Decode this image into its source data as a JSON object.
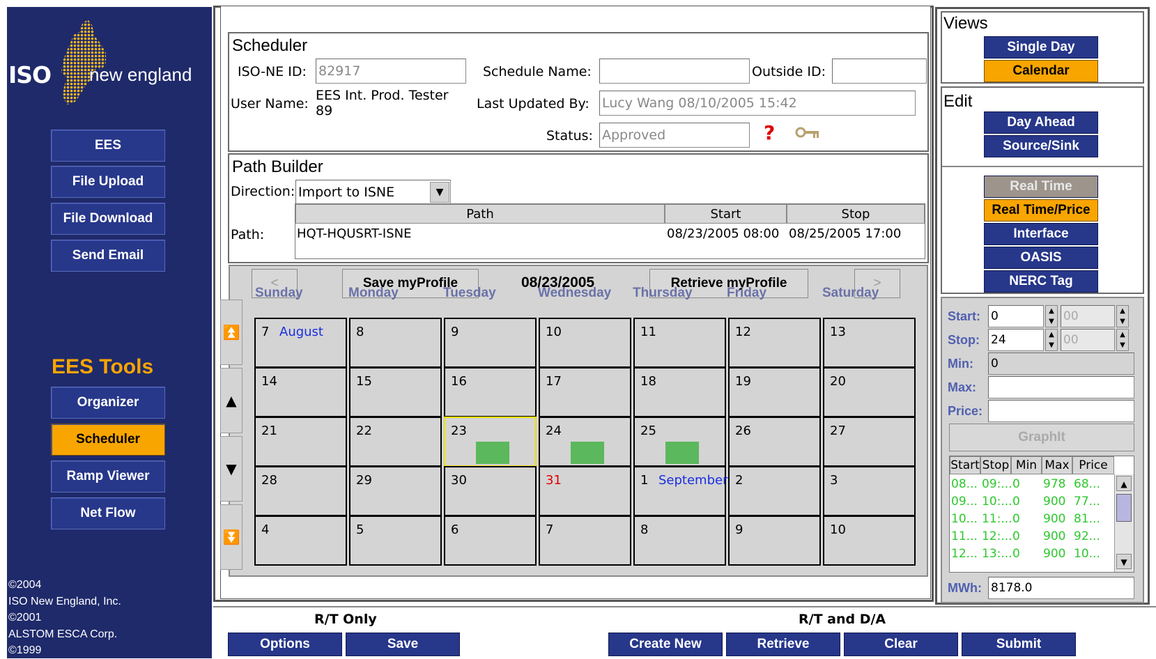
{
  "logo": {
    "iso_text": "ISO",
    "brand_text": "new england"
  },
  "sidebar": {
    "nav": [
      {
        "label": "EES"
      },
      {
        "label": "File Upload"
      },
      {
        "label": "File Download"
      },
      {
        "label": "Send Email"
      }
    ],
    "tools_heading": "EES Tools",
    "tools": [
      {
        "label": "Organizer"
      },
      {
        "label": "Scheduler",
        "active": true
      },
      {
        "label": "Ramp Viewer"
      },
      {
        "label": "Net Flow"
      }
    ],
    "copyright": [
      "©2004",
      "ISO New England, Inc.",
      "©2001",
      "ALSTOM ESCA Corp.",
      "©1999"
    ]
  },
  "scheduler": {
    "title": "Scheduler",
    "iso_ne_id_label": "ISO-NE ID:",
    "iso_ne_id_value": "82917",
    "schedule_name_label": "Schedule Name:",
    "schedule_name_value": "",
    "outside_id_label": "Outside ID:",
    "outside_id_value": "",
    "user_name_label": "User Name:",
    "user_name_value_line1": "EES Int. Prod. Tester",
    "user_name_value_line2": "89",
    "last_updated_label": "Last Updated By:",
    "last_updated_value": "Lucy Wang  08/10/2005 15:42",
    "status_label": "Status:",
    "status_value": "Approved",
    "help_icon_glyph": "?",
    "key_icon_glyph": "⚿"
  },
  "path_builder": {
    "title": "Path Builder",
    "direction_label": "Direction:",
    "direction_value": "Import to ISNE",
    "path_label": "Path:",
    "columns": [
      "Path",
      "Start",
      "Stop"
    ],
    "rows": [
      {
        "path": "HQT-HQUSRT-ISNE",
        "start": "08/23/2005 08:00",
        "stop": "08/25/2005 17:00"
      }
    ]
  },
  "calendar": {
    "prev_label": "<",
    "next_label": ">",
    "save_profile_label": "Save myProfile",
    "retrieve_profile_label": "Retrieve myProfile",
    "current_date": "08/23/2005",
    "day_names": [
      "Sunday",
      "Monday",
      "Tuesday",
      "Wednesday",
      "Thursday",
      "Friday",
      "Saturday"
    ],
    "weeks": [
      [
        {
          "d": "7",
          "month": "August"
        },
        {
          "d": "8"
        },
        {
          "d": "9"
        },
        {
          "d": "10"
        },
        {
          "d": "11"
        },
        {
          "d": "12"
        },
        {
          "d": "13"
        }
      ],
      [
        {
          "d": "14"
        },
        {
          "d": "15"
        },
        {
          "d": "16"
        },
        {
          "d": "17"
        },
        {
          "d": "18"
        },
        {
          "d": "19"
        },
        {
          "d": "20"
        }
      ],
      [
        {
          "d": "21"
        },
        {
          "d": "22"
        },
        {
          "d": "23",
          "selected": true,
          "scheduled": true
        },
        {
          "d": "24",
          "scheduled": true
        },
        {
          "d": "25",
          "scheduled": true
        },
        {
          "d": "26"
        },
        {
          "d": "27"
        }
      ],
      [
        {
          "d": "28"
        },
        {
          "d": "29"
        },
        {
          "d": "30"
        },
        {
          "d": "31",
          "red": true
        },
        {
          "d": "1",
          "month": "September"
        },
        {
          "d": "2"
        },
        {
          "d": "3"
        }
      ],
      [
        {
          "d": "4"
        },
        {
          "d": "5"
        },
        {
          "d": "6"
        },
        {
          "d": "7"
        },
        {
          "d": "8"
        },
        {
          "d": "9"
        },
        {
          "d": "10"
        }
      ]
    ],
    "scroll_glyphs": [
      "⏫",
      "▲",
      "▼",
      "⏬"
    ]
  },
  "views": {
    "title": "Views",
    "buttons": [
      {
        "label": "Single Day"
      },
      {
        "label": "Calendar",
        "active": true
      }
    ]
  },
  "edit": {
    "title": "Edit",
    "buttons": [
      {
        "label": "Day Ahead"
      },
      {
        "label": "Source/Sink"
      }
    ],
    "rt_buttons": [
      {
        "label": "Real Time",
        "disabled": true
      },
      {
        "label": "Real Time/Price",
        "active": true
      },
      {
        "label": "Interface"
      },
      {
        "label": "OASIS"
      },
      {
        "label": "NERC Tag"
      }
    ]
  },
  "range": {
    "start_label": "Start:",
    "start_value": "0",
    "start_min_value": "00",
    "stop_label": "Stop:",
    "stop_value": "24",
    "stop_min_value": "00",
    "min_label": "Min:",
    "min_value": "0",
    "max_label": "Max:",
    "max_value": "",
    "price_label": "Price:",
    "price_value": "",
    "graph_label": "GraphIt",
    "table_columns": [
      "Start",
      "Stop",
      "Min",
      "Max",
      "Price"
    ],
    "table_rows": [
      [
        "08...",
        "09:...",
        "0",
        "978",
        "68..."
      ],
      [
        "09...",
        "10:...",
        "0",
        "900",
        "77..."
      ],
      [
        "10...",
        "11:...",
        "0",
        "900",
        "81..."
      ],
      [
        "11...",
        "12:...",
        "0",
        "900",
        "92..."
      ],
      [
        "12...",
        "13:...",
        "0",
        "900",
        "10..."
      ]
    ],
    "mwh_label": "MWh:",
    "mwh_value": "8178.0"
  },
  "footer": {
    "rt_only_label": "R/T Only",
    "rt_da_label": "R/T and D/A",
    "options_label": "Options",
    "save_label": "Save",
    "create_new_label": "Create New",
    "retrieve_label": "Retrieve",
    "clear_label": "Clear",
    "submit_label": "Submit"
  },
  "colors": {
    "sidebar": "#1f2a6b",
    "button_blue": "#27378a",
    "accent_orange": "#f9a500",
    "schedule_green": "#5cb85c",
    "selected_yellow": "#f0e000"
  }
}
